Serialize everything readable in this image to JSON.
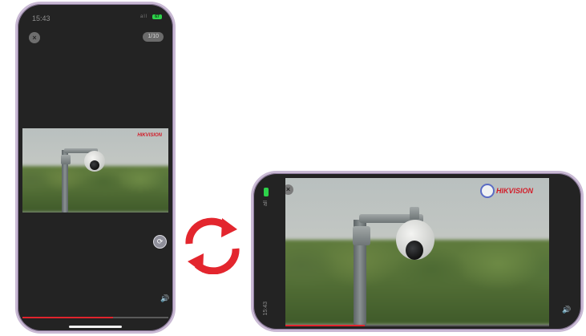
{
  "portrait": {
    "status": {
      "time": "15:43",
      "signal": "all",
      "battery": "67"
    },
    "counter": "1/10",
    "close_icon": "×",
    "watermark": "HIKVISION",
    "sound_icon": "🔊",
    "rotate_icon": "⟳",
    "progress": 0.62
  },
  "landscape": {
    "status": {
      "time": "15:43",
      "signal": "all"
    },
    "watermark": "HIKVISION",
    "close_icon": "×",
    "sound_icon": "🔊",
    "progress": 0.3
  },
  "colors": {
    "accent": "#e0242d",
    "arrow": "#e3262e",
    "frame": "#c9b9d4"
  }
}
